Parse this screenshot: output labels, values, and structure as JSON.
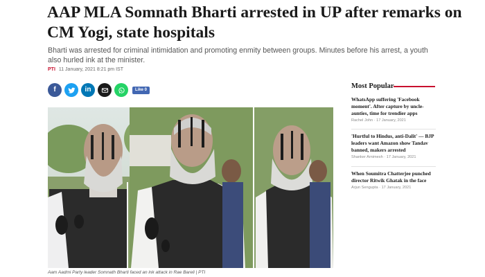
{
  "article": {
    "headline_line1": "AAP MLA Somnath Bharti arrested in UP after remarks on",
    "headline_line2": "CM Yogi, state hospitals",
    "standfirst": "Bharti was arrested for criminal intimidation and promoting enmity between groups. Minutes before his arrest, a youth also hurled ink at the minister.",
    "agency": "PTI",
    "date": "11 January, 2021 8:21 pm IST",
    "caption": "Aam Aadmi Party leader Somnath Bharti faced an ink attack in Rae Bareli | PTI"
  },
  "share": {
    "like_label": "Like 0",
    "buttons": [
      {
        "name": "facebook",
        "glyph": "f",
        "color": "#3b5998"
      },
      {
        "name": "twitter",
        "color": "#1da1f2"
      },
      {
        "name": "linkedin",
        "glyph": "in",
        "color": "#0077b5"
      },
      {
        "name": "email",
        "color": "#1a1a1a"
      },
      {
        "name": "whatsapp",
        "color": "#25d366"
      }
    ]
  },
  "sidebar": {
    "title": "Most Popular",
    "accent": "#c8102e",
    "items": [
      {
        "title": "WhatsApp suffering 'Facebook moment'. After capture by uncle-aunties, time for trendier apps",
        "author": "Rachel John",
        "date": "17 January, 2021"
      },
      {
        "title": "'Hurtful to Hindus, anti-Dalit' — BJP leaders want Amazon show Tandav banned, makers arrested",
        "author": "Shanker Arnimesh",
        "date": "17 January, 2021"
      },
      {
        "title": "When Soumitra Chatterjee punched director Ritwik Ghatak in the face",
        "author": "Arjun Sengupta",
        "date": "17 January, 2021"
      }
    ]
  }
}
